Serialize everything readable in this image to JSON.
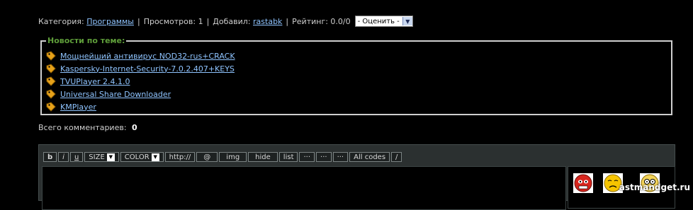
{
  "meta": {
    "category_label": "Категория:",
    "category_link": "Программы",
    "views": "Просмотров: 1",
    "added_label": "Добавил:",
    "added_user": "rastabk",
    "rating": "Рейтинг: 0.0/0",
    "rate_select": "- Оценить -"
  },
  "news": {
    "legend": "Новости по теме:",
    "items": [
      "Мощнейший антивирус NOD32-rus+CRACK",
      "Kaspersky-Internet-Security-7.0.2.407+KEYS",
      "TVUPlayer 2.4.1.0",
      "Universal Share Downloader",
      "KMPlayer"
    ]
  },
  "comments": {
    "total_label": "Всего комментариев:",
    "total_value": "0"
  },
  "toolbar": {
    "b": "b",
    "i": "i",
    "u": "u",
    "size": "SIZE",
    "color": "COLOR",
    "http": "http://",
    "at": "@",
    "img": "img",
    "hide": "hide",
    "list": "list",
    "dots1": "···",
    "dots2": "···",
    "dots3": "···",
    "all_codes": "All codes",
    "slash": "/"
  },
  "watermark": "astmandget.ru"
}
